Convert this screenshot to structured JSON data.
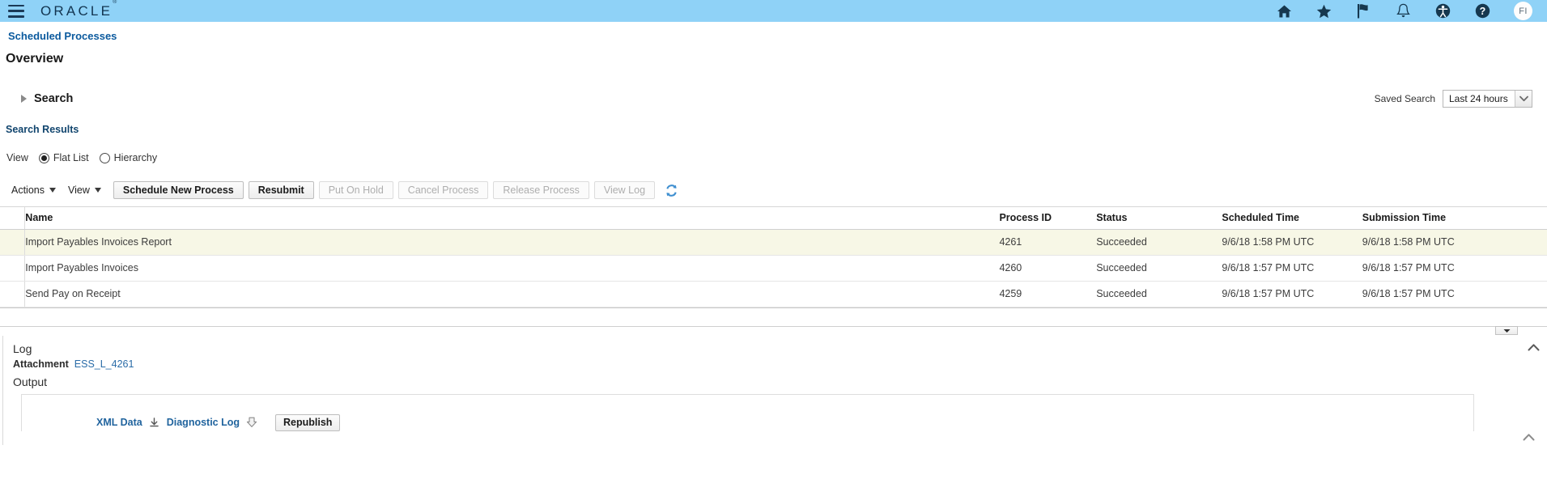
{
  "header": {
    "menu_icon": "hamburger-menu-icon",
    "logo_text": "ORACLE",
    "logo_mark": "®",
    "icons": [
      {
        "name": "home-icon",
        "title": "Home"
      },
      {
        "name": "favorites-star-icon",
        "title": "Favorites"
      },
      {
        "name": "flag-icon",
        "title": "Watchlist"
      },
      {
        "name": "notifications-bell-icon",
        "title": "Notifications"
      },
      {
        "name": "accessibility-icon",
        "title": "Accessibility"
      },
      {
        "name": "help-icon",
        "title": "Help"
      }
    ],
    "avatar_initials": "FI",
    "background_color": "#8fd2f7"
  },
  "breadcrumb": {
    "label": "Scheduled Processes"
  },
  "page": {
    "title": "Overview"
  },
  "search": {
    "label": "Search",
    "expanded": false,
    "saved_search_label": "Saved Search",
    "saved_search_value": "Last 24 hours"
  },
  "results": {
    "heading": "Search Results",
    "view_label": "View",
    "view_options": [
      {
        "label": "Flat List",
        "selected": true
      },
      {
        "label": "Hierarchy",
        "selected": false
      }
    ]
  },
  "toolbar": {
    "actions_menu": "Actions",
    "view_menu": "View",
    "buttons": [
      {
        "label": "Schedule New Process",
        "enabled": true
      },
      {
        "label": "Resubmit",
        "enabled": true
      },
      {
        "label": "Put On Hold",
        "enabled": false
      },
      {
        "label": "Cancel Process",
        "enabled": false
      },
      {
        "label": "Release Process",
        "enabled": false
      },
      {
        "label": "View Log",
        "enabled": false
      }
    ],
    "refresh_icon": "refresh-icon",
    "refresh_color": "#3f8fd0"
  },
  "table": {
    "columns": [
      "Name",
      "Process ID",
      "Status",
      "Scheduled Time",
      "Submission Time"
    ],
    "rows": [
      {
        "name": "Import Payables Invoices Report",
        "process_id": "4261",
        "status": "Succeeded",
        "scheduled_time": "9/6/18 1:58 PM UTC",
        "submission_time": "9/6/18 1:58 PM UTC",
        "selected": true
      },
      {
        "name": "Import Payables Invoices",
        "process_id": "4260",
        "status": "Succeeded",
        "scheduled_time": "9/6/18 1:57 PM UTC",
        "submission_time": "9/6/18 1:57 PM UTC",
        "selected": false
      },
      {
        "name": "Send Pay on Receipt",
        "process_id": "4259",
        "status": "Succeeded",
        "scheduled_time": "9/6/18 1:57 PM UTC",
        "submission_time": "9/6/18 1:57 PM UTC",
        "selected": false
      }
    ],
    "selected_row_color": "#f7f7e6"
  },
  "detail": {
    "log_title": "Log",
    "attachment_label": "Attachment",
    "attachment_name": "ESS_L_4261",
    "output_title": "Output",
    "output_links": [
      {
        "label": "XML Data",
        "icon": "download-icon"
      },
      {
        "label": "Diagnostic Log",
        "icon": "download-icon"
      }
    ],
    "republish_label": "Republish"
  }
}
